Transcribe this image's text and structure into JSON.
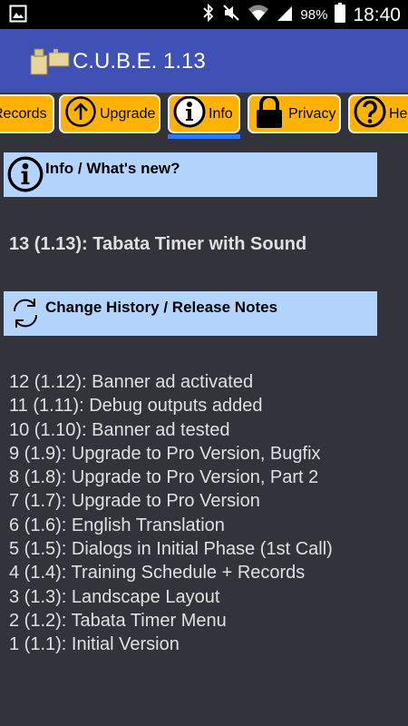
{
  "status_bar": {
    "battery_percent": "98%",
    "time": "18:40",
    "icons": [
      "image-icon",
      "bluetooth-icon",
      "mute-icon",
      "wifi-icon",
      "signal-icon",
      "battery-icon"
    ]
  },
  "app_bar": {
    "title": "C.U.B.E. 1.13",
    "icon": "app-logo-icon",
    "color": "#3f51b5"
  },
  "tabs": [
    {
      "label": "Records",
      "icon": "records-icon"
    },
    {
      "label": "Upgrade",
      "icon": "arrow-up-circle-icon"
    },
    {
      "label": "Info",
      "icon": "info-icon",
      "selected": true
    },
    {
      "label": "Privacy",
      "icon": "lock-icon"
    },
    {
      "label": "He",
      "icon": "help-icon"
    }
  ],
  "info_section": {
    "title": "Info / What's new?",
    "current_version": "13 (1.13): Tabata Timer with Sound"
  },
  "history_section": {
    "title": "Change History / Release Notes",
    "entries": [
      "12 (1.12): Banner ad activated",
      "11 (1.11): Debug outputs added",
      "10 (1.10): Banner ad tested",
      "9 (1.9): Upgrade to Pro Version, Bugfix",
      "8 (1.8): Upgrade to Pro Version, Part 2",
      "7 (1.7): Upgrade to Pro Version",
      "6 (1.6): English Translation",
      "5 (1.5): Dialogs in Initial Phase (1st Call)",
      "4 (1.4): Training Schedule + Records",
      "3 (1.3): Landscape Layout",
      "2 (1.2): Tabata Timer Menu",
      "1 (1.1): Initial Version"
    ]
  },
  "colors": {
    "background": "#33333b",
    "tab_background": "#ffb300",
    "header_background": "#b3d4fc",
    "indicator": "#2979ff"
  }
}
